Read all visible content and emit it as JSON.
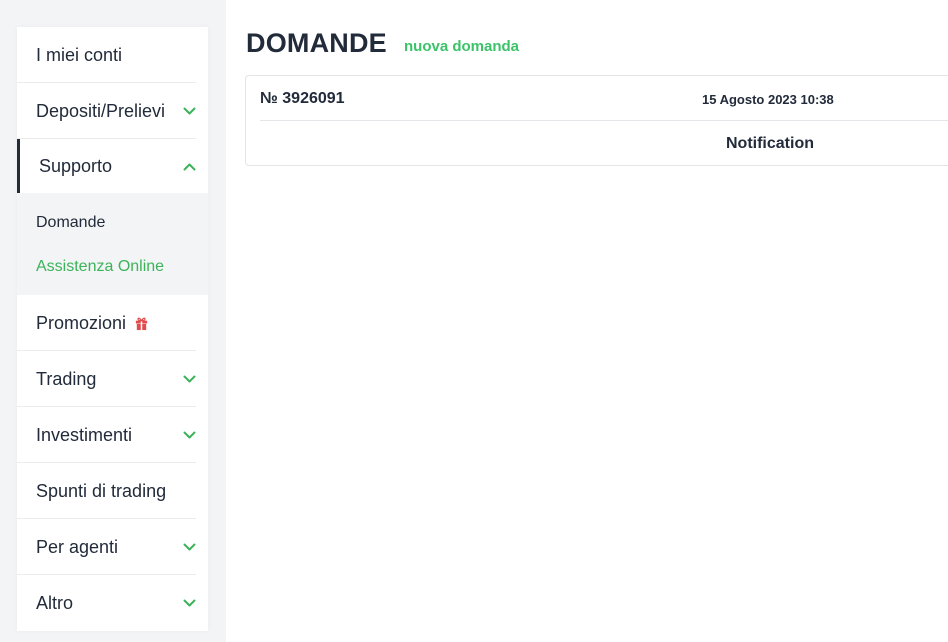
{
  "colors": {
    "accent_green": "#3cb35a",
    "text_dark": "#222b3a",
    "gift_red": "#e24b4b"
  },
  "sidebar": {
    "items": [
      {
        "label": "I miei conti",
        "chevron": "none"
      },
      {
        "label": "Depositi/Prelievi",
        "chevron": "down"
      },
      {
        "label": "Supporto",
        "chevron": "up",
        "active": true
      },
      {
        "label": "Promozioni",
        "icon": "gift-icon"
      },
      {
        "label": "Trading",
        "chevron": "down"
      },
      {
        "label": "Investimenti",
        "chevron": "down"
      },
      {
        "label": "Spunti di trading",
        "chevron": "none"
      },
      {
        "label": "Per agenti",
        "chevron": "down"
      },
      {
        "label": "Altro",
        "chevron": "down"
      }
    ],
    "submenu": [
      {
        "label": "Domande"
      },
      {
        "label": "Assistenza Online"
      }
    ]
  },
  "main": {
    "title": "DOMANDE",
    "new_question_link": "nuova domanda",
    "ticket": {
      "number": "№ 3926091",
      "date": "15 Agosto 2023 10:38",
      "subject": "Notification"
    }
  }
}
